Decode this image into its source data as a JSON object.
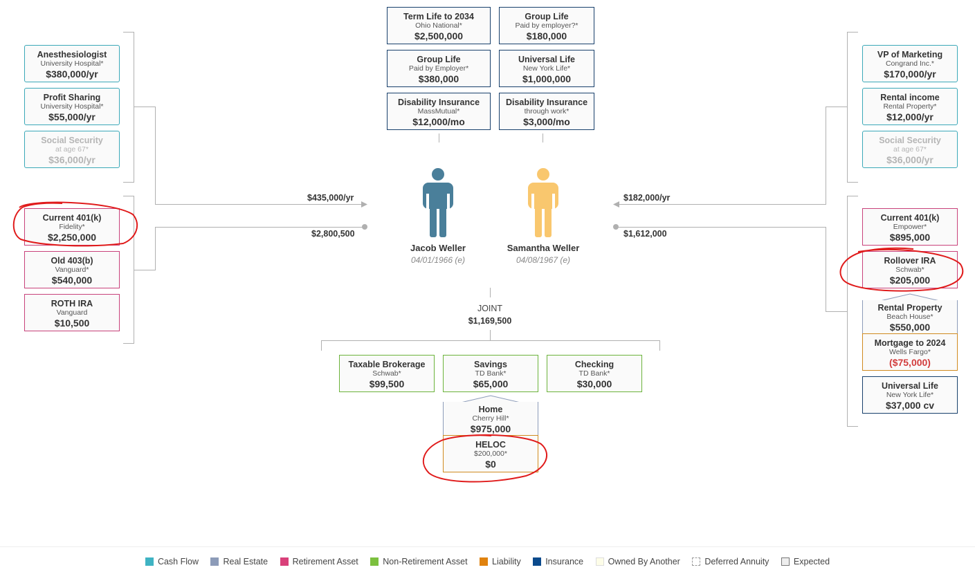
{
  "left_income": [
    {
      "title": "Anesthesiologist",
      "sub": "University Hospital*",
      "value": "$380,000/yr"
    },
    {
      "title": "Profit Sharing",
      "sub": "University Hospital*",
      "value": "$55,000/yr"
    },
    {
      "title": "Social Security",
      "sub": "at age 67*",
      "value": "$36,000/yr"
    }
  ],
  "left_assets": [
    {
      "title": "Current 401(k)",
      "sub": "Fidelity*",
      "value": "$2,250,000"
    },
    {
      "title": "Old 403(b)",
      "sub": "Vanguard*",
      "value": "$540,000"
    },
    {
      "title": "ROTH IRA",
      "sub": "Vanguard",
      "value": "$10,500"
    }
  ],
  "insurance_left": [
    {
      "title": "Term Life to 2034",
      "sub": "Ohio National*",
      "value": "$2,500,000"
    },
    {
      "title": "Group Life",
      "sub": "Paid by Employer*",
      "value": "$380,000"
    },
    {
      "title": "Disability Insurance",
      "sub": "MassMutual*",
      "value": "$12,000/mo"
    }
  ],
  "insurance_right": [
    {
      "title": "Group Life",
      "sub": "Paid by employer?*",
      "value": "$180,000"
    },
    {
      "title": "Universal Life",
      "sub": "New York Life*",
      "value": "$1,000,000"
    },
    {
      "title": "Disability Insurance",
      "sub": "through work*",
      "value": "$3,000/mo"
    }
  ],
  "right_income": [
    {
      "title": "VP of Marketing",
      "sub": "Congrand Inc.*",
      "value": "$170,000/yr"
    },
    {
      "title": "Rental income",
      "sub": "Rental Property*",
      "value": "$12,000/yr"
    },
    {
      "title": "Social Security",
      "sub": "at age 67*",
      "value": "$36,000/yr"
    }
  ],
  "right_assets": [
    {
      "title": "Current 401(k)",
      "sub": "Empower*",
      "value": "$895,000"
    },
    {
      "title": "Rollover IRA",
      "sub": "Schwab*",
      "value": "$205,000"
    },
    {
      "title": "Rental Property",
      "sub": "Beach House*",
      "value": "$550,000"
    },
    {
      "title": "Mortgage to 2024",
      "sub": "Wells Fargo*",
      "value": "($75,000)"
    },
    {
      "title": "Universal Life",
      "sub": "New York Life*",
      "value": "$37,000 cv"
    }
  ],
  "joint": {
    "label": "JOINT",
    "total": "$1,169,500",
    "accounts": [
      {
        "title": "Taxable Brokerage",
        "sub": "Schwab*",
        "value": "$99,500"
      },
      {
        "title": "Savings",
        "sub": "TD Bank*",
        "value": "$65,000"
      },
      {
        "title": "Checking",
        "sub": "TD Bank*",
        "value": "$30,000"
      }
    ],
    "home": {
      "title": "Home",
      "sub": "Cherry Hill*",
      "value": "$975,000"
    },
    "heloc": {
      "title": "HELOC",
      "sub": "$200,000*",
      "value": "$0"
    }
  },
  "jacob": {
    "name": "Jacob Weller",
    "dob": "04/01/1966 (e)",
    "income": "$435,000/yr",
    "assets": "$2,800,500"
  },
  "samantha": {
    "name": "Samantha Weller",
    "dob": "04/08/1967 (e)",
    "income": "$182,000/yr",
    "assets": "$1,612,000"
  },
  "colors": {
    "jacob": "#4a7f9a",
    "samantha": "#f9c76e",
    "annotation": "#e01b1b"
  },
  "legend": [
    {
      "label": "Cash Flow",
      "color": "#3fb3c3"
    },
    {
      "label": "Real Estate",
      "color": "#8c9bb8"
    },
    {
      "label": "Retirement Asset",
      "color": "#d9407a"
    },
    {
      "label": "Non-Retirement Asset",
      "color": "#7cc03f"
    },
    {
      "label": "Liability",
      "color": "#e0820e"
    },
    {
      "label": "Insurance",
      "color": "#0b4a8c"
    },
    {
      "label": "Owned By Another",
      "color": "#fdfde8"
    },
    {
      "label": "Deferred Annuity",
      "color": "#ffffff"
    },
    {
      "label": "Expected",
      "color": "#eeeeee"
    }
  ]
}
